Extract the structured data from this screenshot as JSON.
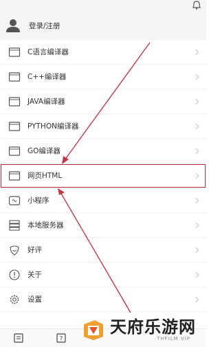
{
  "header": {
    "login_label": "登录/注册",
    "icons": {
      "avatar": "user-avatar-icon",
      "bell": "bell-icon"
    }
  },
  "menu": {
    "items": [
      {
        "label": "C语言编译器",
        "icon": "c-compiler-icon"
      },
      {
        "label": "C++编译器",
        "icon": "cpp-compiler-icon"
      },
      {
        "label": "JAVA编译器",
        "icon": "java-compiler-icon"
      },
      {
        "label": "PYTHON编译器",
        "icon": "python-compiler-icon"
      },
      {
        "label": "GO编译器",
        "icon": "go-compiler-icon"
      },
      {
        "label": "网页HTML",
        "icon": "html-icon",
        "highlighted": true
      },
      {
        "label": "小程序",
        "icon": "mini-program-icon"
      },
      {
        "label": "本地服务器",
        "icon": "server-icon"
      },
      {
        "label": "好评",
        "icon": "rate-icon"
      },
      {
        "label": "关于",
        "icon": "info-icon"
      },
      {
        "label": "设置",
        "icon": "gear-icon"
      }
    ]
  },
  "bottom_bar": {
    "icons": [
      "home-icon",
      "help-icon"
    ]
  },
  "watermark": {
    "brand": "天府乐游网",
    "sub": "THFILM VIP"
  },
  "colors": {
    "highlight": "#b3263a",
    "arrow": "#c0394b",
    "header_bg": "#f5f5f5"
  }
}
